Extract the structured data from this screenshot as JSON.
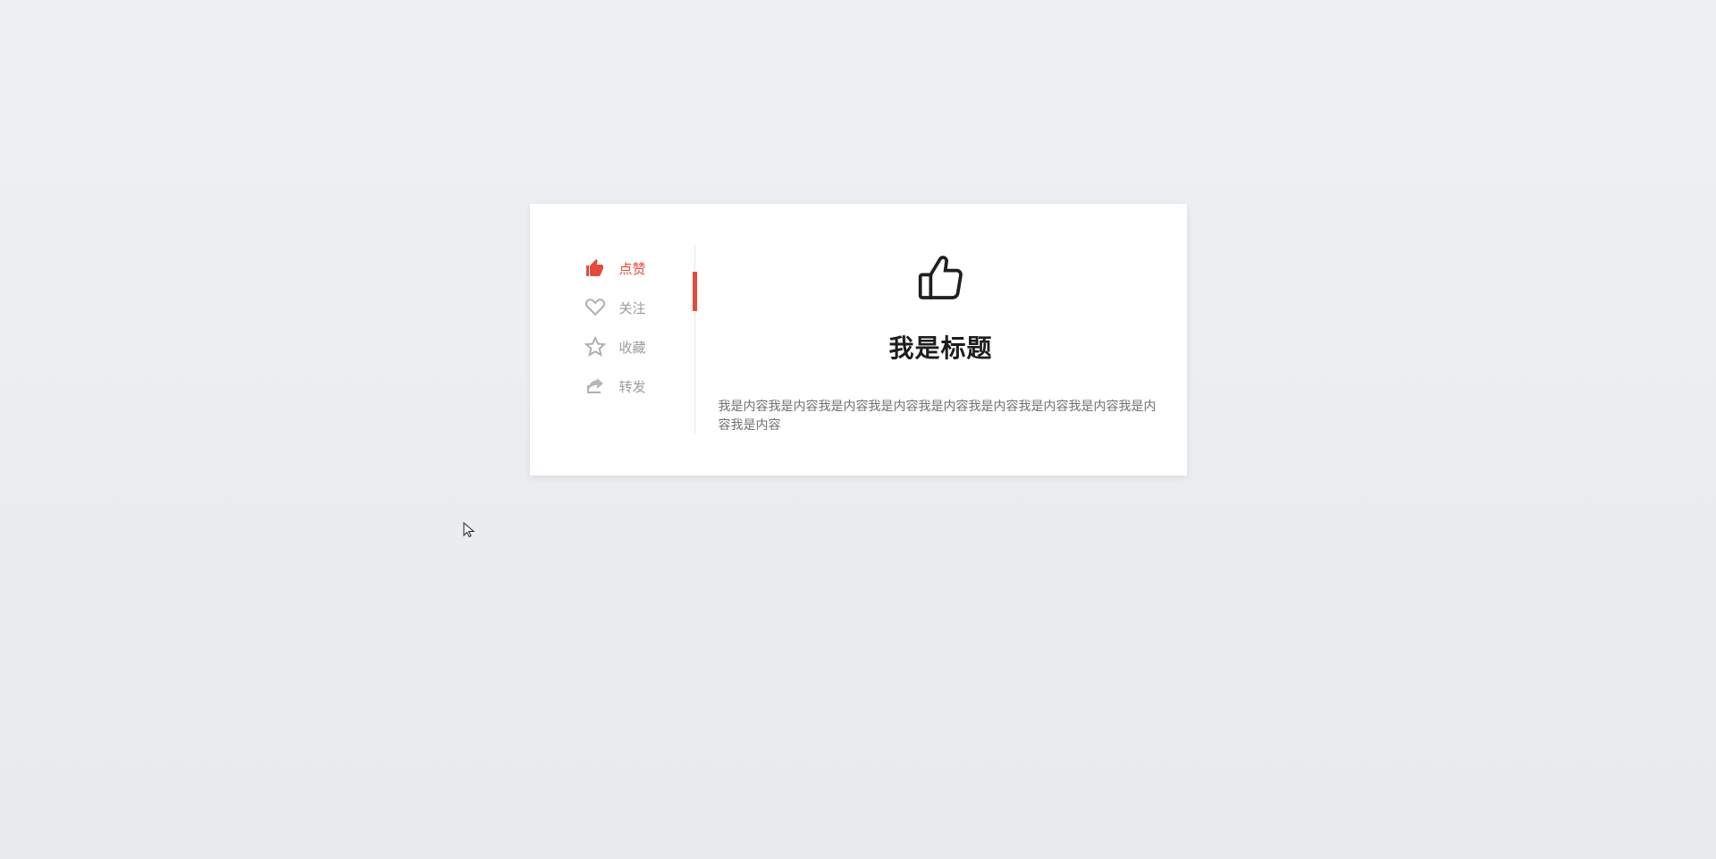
{
  "tabs": [
    {
      "id": "like",
      "label": "点赞",
      "icon": "thumbs-up-icon",
      "active": true
    },
    {
      "id": "follow",
      "label": "关注",
      "icon": "heart-icon",
      "active": false
    },
    {
      "id": "favorite",
      "label": "收藏",
      "icon": "star-icon",
      "active": false
    },
    {
      "id": "share",
      "label": "转发",
      "icon": "share-icon",
      "active": false
    }
  ],
  "content": {
    "icon": "thumbs-up-icon",
    "title": "我是标题",
    "body": "我是内容我是内容我是内容我是内容我是内容我是内容我是内容我是内容我是内容我是内容"
  },
  "colors": {
    "accent": "#e64a3b",
    "muted": "#aeb0b3",
    "text": "#1d1d1d"
  }
}
